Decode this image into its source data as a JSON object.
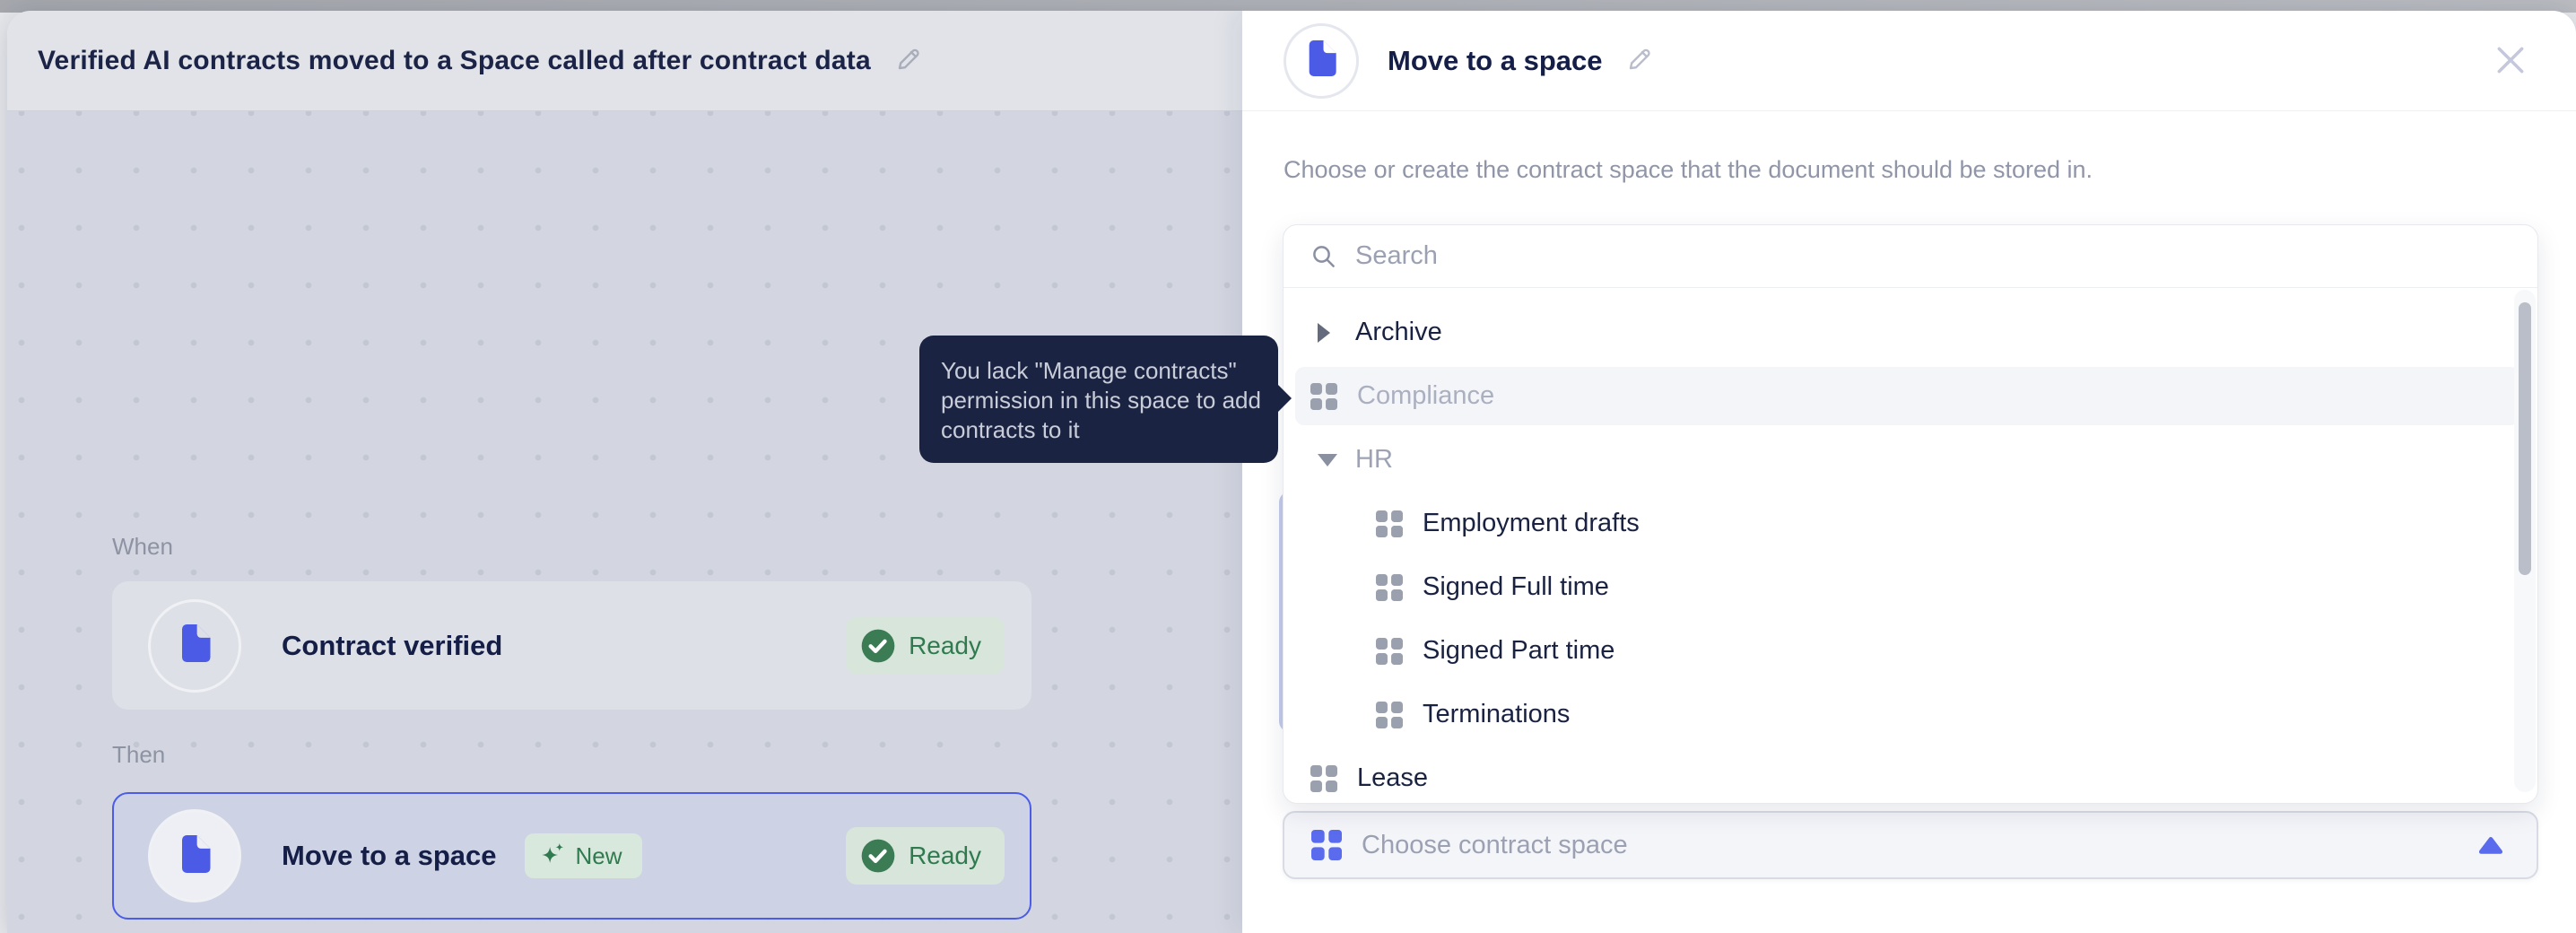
{
  "workflow": {
    "title": "Verified AI contracts moved to a Space called after contract data",
    "when_label": "When",
    "then_label": "Then",
    "trigger_card": {
      "title": "Contract verified",
      "status": "Ready"
    },
    "action_card": {
      "title": "Move to a space",
      "badge": "New",
      "status": "Ready"
    },
    "tooltip": {
      "line1": "You lack \"Manage contracts\"",
      "line2": "permission in this space to add",
      "line3": "contracts to it"
    }
  },
  "panel": {
    "title": "Move to a space",
    "description": "Choose or create the contract space that the document should be stored in.",
    "search": {
      "placeholder": "Search"
    },
    "tree": [
      {
        "label": "Archive"
      },
      {
        "label": "Compliance"
      },
      {
        "label": "HR"
      },
      {
        "label": "Employment drafts"
      },
      {
        "label": "Signed Full time"
      },
      {
        "label": "Signed Part time"
      },
      {
        "label": "Terminations"
      },
      {
        "label": "Lease"
      }
    ],
    "select": {
      "placeholder": "Choose contract space"
    }
  },
  "colors": {
    "accent": "#4A5CE8",
    "doc_icon": "#4B5BE6",
    "success": "#2F7A4E",
    "success_badge_bg": "#D7E5DB",
    "tooltip_bg": "#1A2342",
    "canvas_bg": "#D3D6E0",
    "selected_card_bg": "#CDD2E4"
  }
}
